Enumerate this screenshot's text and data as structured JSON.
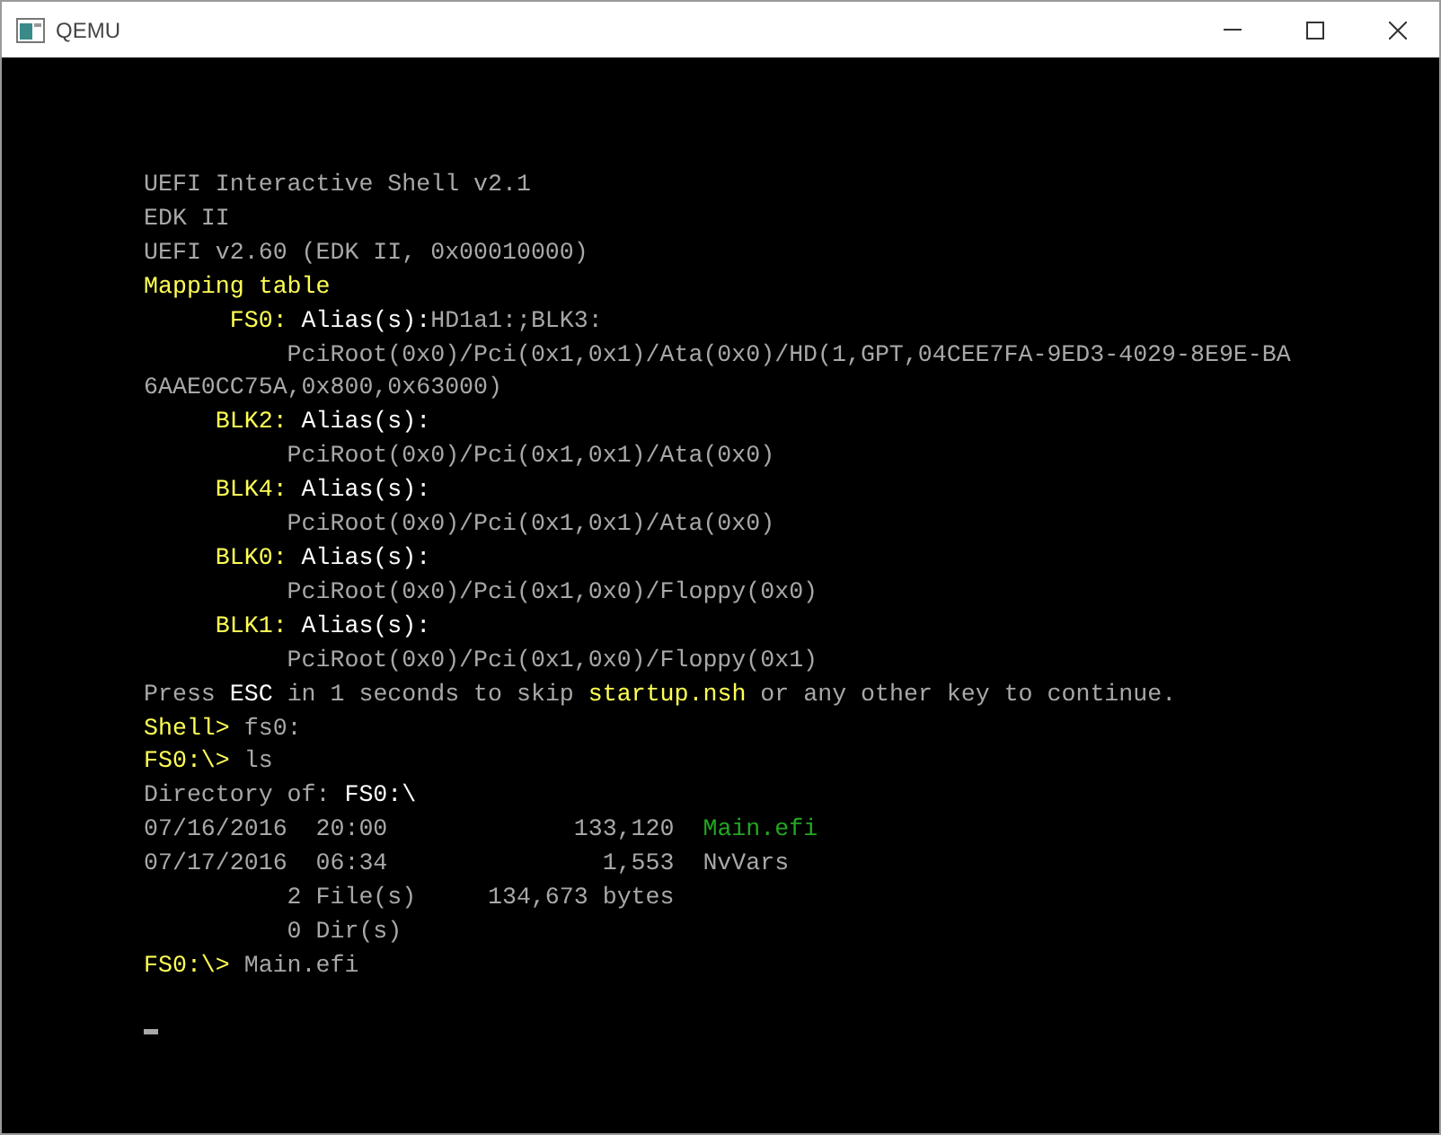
{
  "window": {
    "title": "QEMU"
  },
  "terminal": {
    "lines": [
      {
        "segments": [
          {
            "text": "UEFI Interactive Shell v2.1",
            "kind": "normal"
          }
        ]
      },
      {
        "segments": [
          {
            "text": "EDK II",
            "kind": "normal"
          }
        ]
      },
      {
        "segments": [
          {
            "text": "UEFI v2.60 (EDK II, 0x00010000)",
            "kind": "normal"
          }
        ]
      },
      {
        "segments": [
          {
            "text": "Mapping table",
            "kind": "yellow"
          }
        ]
      },
      {
        "segments": [
          {
            "text": "      FS0:",
            "kind": "yellow"
          },
          {
            "text": " Alias(s):",
            "kind": "bright"
          },
          {
            "text": "HD1a1:;BLK3:",
            "kind": "normal"
          }
        ]
      },
      {
        "segments": [
          {
            "text": "          PciRoot(0x0)/Pci(0x1,0x1)/Ata(0x0)/HD(1,GPT,04CEE7FA-9ED3-4029-8E9E-BA",
            "kind": "normal"
          }
        ]
      },
      {
        "segments": [
          {
            "text": "6AAE0CC75A,0x800,0x63000)",
            "kind": "normal"
          }
        ]
      },
      {
        "segments": [
          {
            "text": "     BLK2:",
            "kind": "yellow"
          },
          {
            "text": " Alias(s):",
            "kind": "bright"
          }
        ]
      },
      {
        "segments": [
          {
            "text": "          PciRoot(0x0)/Pci(0x1,0x1)/Ata(0x0)",
            "kind": "normal"
          }
        ]
      },
      {
        "segments": [
          {
            "text": "     BLK4:",
            "kind": "yellow"
          },
          {
            "text": " Alias(s):",
            "kind": "bright"
          }
        ]
      },
      {
        "segments": [
          {
            "text": "          PciRoot(0x0)/Pci(0x1,0x1)/Ata(0x0)",
            "kind": "normal"
          }
        ]
      },
      {
        "segments": [
          {
            "text": "     BLK0:",
            "kind": "yellow"
          },
          {
            "text": " Alias(s):",
            "kind": "bright"
          }
        ]
      },
      {
        "segments": [
          {
            "text": "          PciRoot(0x0)/Pci(0x1,0x0)/Floppy(0x0)",
            "kind": "normal"
          }
        ]
      },
      {
        "segments": [
          {
            "text": "     BLK1:",
            "kind": "yellow"
          },
          {
            "text": " Alias(s):",
            "kind": "bright"
          }
        ]
      },
      {
        "segments": [
          {
            "text": "          PciRoot(0x0)/Pci(0x1,0x0)/Floppy(0x1)",
            "kind": "normal"
          }
        ]
      },
      {
        "segments": [
          {
            "text": "Press ",
            "kind": "normal"
          },
          {
            "text": "ESC",
            "kind": "bright"
          },
          {
            "text": " in 1 seconds to skip ",
            "kind": "normal"
          },
          {
            "text": "startup.nsh",
            "kind": "yellow"
          },
          {
            "text": " or any other key to continue.",
            "kind": "normal"
          }
        ]
      },
      {
        "segments": [
          {
            "text": "Shell>",
            "kind": "yellow"
          },
          {
            "text": " fs0:",
            "kind": "normal"
          }
        ]
      },
      {
        "segments": [
          {
            "text": "FS0:\\>",
            "kind": "yellow"
          },
          {
            "text": " ls",
            "kind": "normal"
          }
        ]
      },
      {
        "segments": [
          {
            "text": "Directory of:",
            "kind": "normal"
          },
          {
            "text": " FS0:\\",
            "kind": "bright"
          }
        ]
      },
      {
        "segments": [
          {
            "text": "07/16/2016  20:00             133,120",
            "kind": "normal"
          },
          {
            "text": "  Main.efi",
            "kind": "green"
          }
        ]
      },
      {
        "segments": [
          {
            "text": "07/17/2016  06:34               1,553  NvVars",
            "kind": "normal"
          }
        ]
      },
      {
        "segments": [
          {
            "text": "          2 File(s)     134,673 bytes",
            "kind": "normal"
          }
        ]
      },
      {
        "segments": [
          {
            "text": "          0 Dir(s)",
            "kind": "normal"
          }
        ]
      },
      {
        "segments": [
          {
            "text": "FS0:\\>",
            "kind": "yellow"
          },
          {
            "text": " Main.efi",
            "kind": "normal"
          }
        ]
      }
    ]
  }
}
